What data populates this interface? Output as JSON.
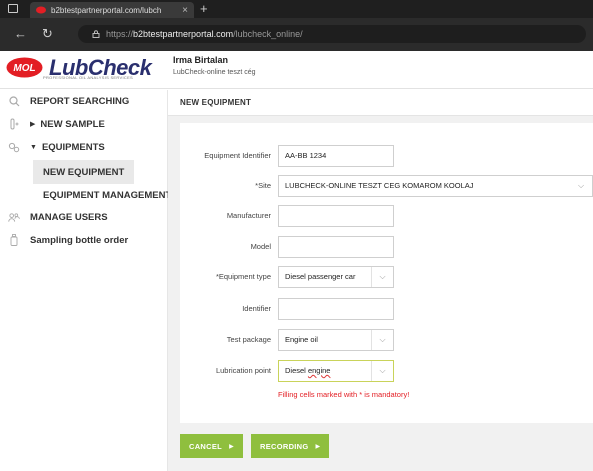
{
  "browser": {
    "tab_title": "b2btestpartnerportal.com/lubch",
    "tab_close": "×",
    "new_tab": "+",
    "url_scheme": "https://",
    "url_host": "b2btestpartnerportal.com",
    "url_path": "/lubcheck_online/"
  },
  "header": {
    "brand": "LubCheck",
    "brand_tagline": "PROFESSIONAL OIL ANALYSIS SERVICES",
    "logo_mark": "MOL",
    "user_name": "Irma Birtalan",
    "company": "LubCheck-online teszt cég"
  },
  "sidebar": {
    "items": [
      {
        "label": "REPORT SEARCHING",
        "icon": "search-icon"
      },
      {
        "label": "NEW SAMPLE",
        "icon": "sample-tube-icon",
        "caret": "▶"
      },
      {
        "label": "EQUIPMENTS",
        "icon": "gears-icon",
        "caret": "▼"
      },
      {
        "label": "MANAGE USERS",
        "icon": "users-icon"
      },
      {
        "label": "Sampling bottle order",
        "icon": "bottle-icon"
      }
    ],
    "sub_items": [
      {
        "label": "NEW EQUIPMENT"
      },
      {
        "label": "EQUIPMENT MANAGEMENT"
      }
    ]
  },
  "page": {
    "title": "NEW EQUIPMENT"
  },
  "form": {
    "equipment_identifier": {
      "label": "Equipment Identifier",
      "value": "AA-BB 1234"
    },
    "site": {
      "label": "*Site",
      "value": "LUBCHECK-ONLINE TESZT CEG KOMAROM KOOLAJ"
    },
    "manufacturer": {
      "label": "Manufacturer",
      "value": ""
    },
    "model": {
      "label": "Model",
      "value": ""
    },
    "equipment_type": {
      "label": "*Equipment type",
      "value": "Diesel passenger car"
    },
    "identifier": {
      "label": "Identifier",
      "value": ""
    },
    "test_package": {
      "label": "Test package",
      "value": "Engine oil"
    },
    "lubrication_point": {
      "label": "Lubrication point",
      "value_pre": "Diesel ",
      "value_spell": "engine"
    },
    "error": "Filling cells marked with * is mandatory!"
  },
  "actions": {
    "cancel": "CANCEL",
    "record": "RECORDING",
    "arrow": "▶"
  },
  "colors": {
    "accent_green": "#8fbf3e",
    "error_red": "#e31e24",
    "brand_navy": "#2a2f6e",
    "brand_red": "#e31e24"
  }
}
